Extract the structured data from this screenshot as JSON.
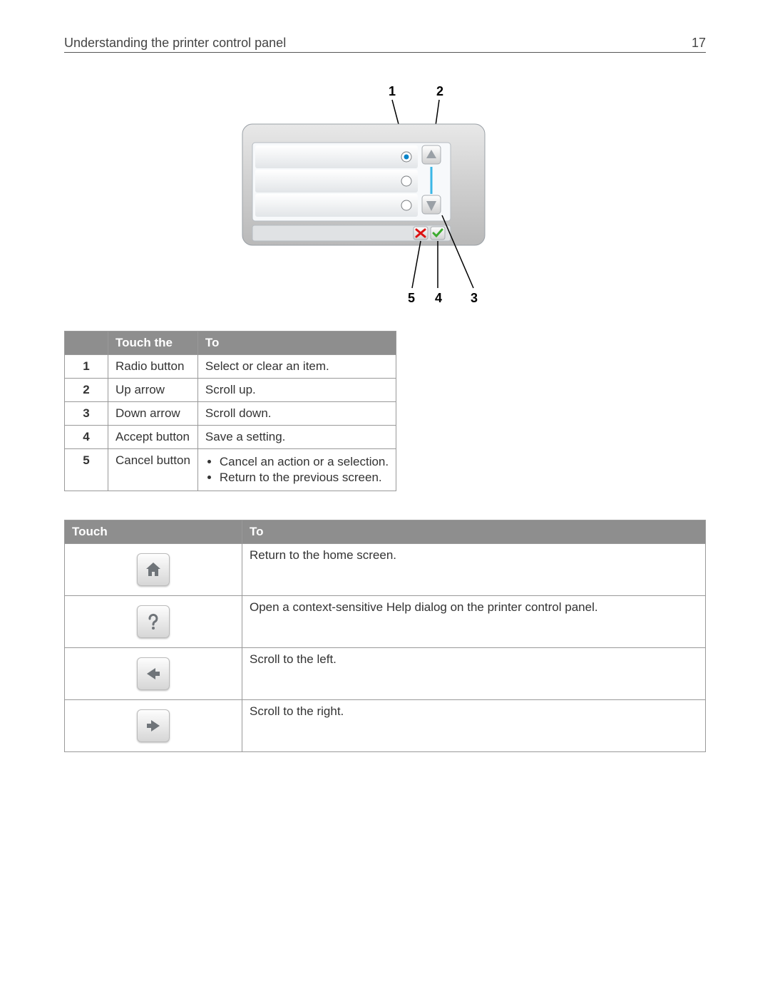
{
  "header": {
    "title": "Understanding the printer control panel",
    "page": "17"
  },
  "callouts": {
    "c1": "1",
    "c2": "2",
    "c3": "3",
    "c4": "4",
    "c5": "5"
  },
  "table1": {
    "heads": {
      "blank": "",
      "touch": "Touch the",
      "to": "To"
    },
    "rows": [
      {
        "n": "1",
        "name": "Radio button",
        "to_text": "Select or clear an item."
      },
      {
        "n": "2",
        "name": "Up arrow",
        "to_text": "Scroll up."
      },
      {
        "n": "3",
        "name": "Down arrow",
        "to_text": "Scroll down."
      },
      {
        "n": "4",
        "name": "Accept button",
        "to_text": "Save a setting."
      },
      {
        "n": "5",
        "name": "Cancel button",
        "to_list": [
          "Cancel an action or a selection.",
          "Return to the previous screen."
        ]
      }
    ]
  },
  "table2": {
    "heads": {
      "touch": "Touch",
      "to": "To"
    },
    "rows": [
      {
        "icon": "home-icon",
        "to": "Return to the home screen."
      },
      {
        "icon": "help-icon",
        "to": "Open a context-sensitive Help dialog on the printer control panel."
      },
      {
        "icon": "arrow-left-icon",
        "to": "Scroll to the left."
      },
      {
        "icon": "arrow-right-icon",
        "to": "Scroll to the right."
      }
    ]
  }
}
